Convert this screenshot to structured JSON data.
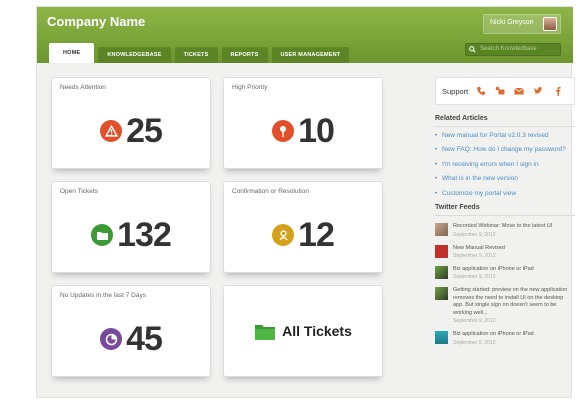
{
  "header": {
    "company": "Company Name",
    "user_name": "Nicki Greyson",
    "search_placeholder": "Search Knowledbase",
    "tabs": [
      "HOME",
      "KNOWLEDGEBASE",
      "TICKETS",
      "REPORTS",
      "USER MANAGEMENT"
    ],
    "accent": "#76a035"
  },
  "cards": [
    {
      "title": "Needs Attention",
      "value": "25",
      "icon": "warning-icon",
      "color": "#e1502a"
    },
    {
      "title": "High Priority",
      "value": "10",
      "icon": "pin-icon",
      "color": "#e1502a"
    },
    {
      "title": "Open Tickets",
      "value": "132",
      "icon": "folder-icon",
      "color": "#3c9a35"
    },
    {
      "title": "Confirmation or Resolution",
      "value": "12",
      "icon": "handshake-icon",
      "color": "#d4a21a"
    },
    {
      "title": "No Updates in the last 7 Days",
      "value": "45",
      "icon": "clock-icon",
      "color": "#7a4a9a"
    },
    {
      "title": "",
      "value": "All Tickets",
      "icon": "folder-icon",
      "color": "#3c9a35"
    }
  ],
  "support": {
    "label": "Support",
    "icons": [
      "phone-icon",
      "chat-icon",
      "email-icon",
      "twitter-icon",
      "facebook-icon"
    ],
    "icon_color": "#e06a2a"
  },
  "related": {
    "title": "Related Articles",
    "items": [
      "New manual for Portal v2.0.3 revised",
      "New FAQ: How do I change my password?",
      "I'm receiving errors when I sign in",
      "What is in the new version",
      "Customize my portal view"
    ]
  },
  "twitter": {
    "title": "Twitter Feeds",
    "items": [
      {
        "text": "Recorded Webinar: Move to the latest UI",
        "date": "September 9, 2012"
      },
      {
        "text": "New Manual Revised",
        "date": "September 9, 2012"
      },
      {
        "text": "Biz application on iPhone or iPad",
        "date": "September 9, 2012"
      },
      {
        "text": "Getting started: preview on the new application removes the need to install UI on the desktop app. But single sign on doesn't seem to be working well...",
        "date": "September 9, 2012"
      },
      {
        "text": "Biz application on iPhone or iPad",
        "date": "September 9, 2012"
      }
    ]
  }
}
